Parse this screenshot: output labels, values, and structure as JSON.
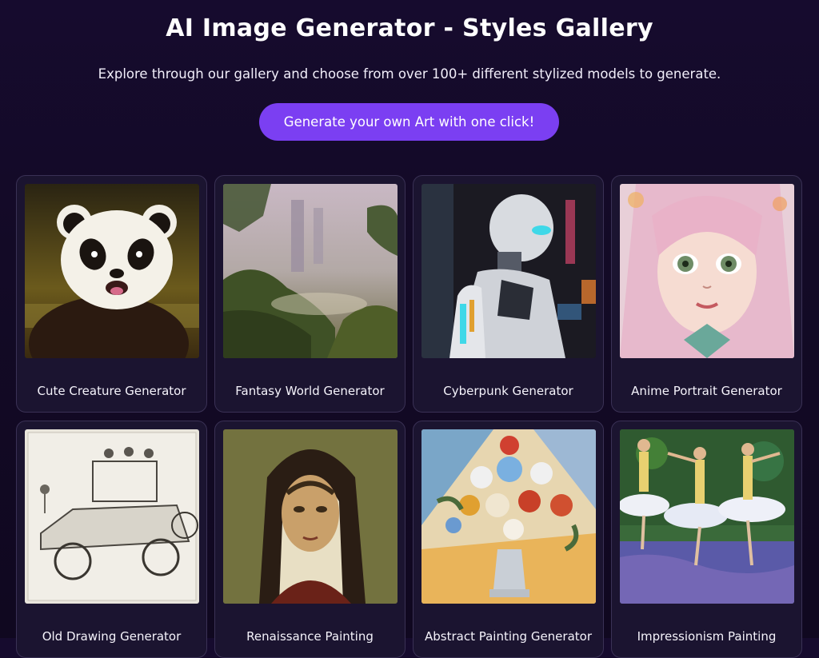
{
  "header": {
    "title": "AI Image Generator - Styles Gallery",
    "subtitle": "Explore through our gallery and choose from over 100+ different stylized models to generate.",
    "cta_label": "Generate your own Art with one click!"
  },
  "colors": {
    "background": "#140a28",
    "accent": "#7b3ff2",
    "card_bg": "#1b1430",
    "card_border": "#3a3155"
  },
  "gallery": {
    "cards": [
      {
        "label": "Cute Creature Generator",
        "image": "panda-image"
      },
      {
        "label": "Fantasy World Generator",
        "image": "fantasy-forest-image"
      },
      {
        "label": "Cyberpunk Generator",
        "image": "cyberpunk-robot-image"
      },
      {
        "label": "Anime Portrait Generator",
        "image": "anime-girl-image"
      },
      {
        "label": "Old Drawing Generator",
        "image": "vintage-car-sketch-image"
      },
      {
        "label": "Renaissance Painting",
        "image": "renaissance-portrait-image"
      },
      {
        "label": "Abstract Painting Generator",
        "image": "flower-vase-painting-image"
      },
      {
        "label": "Impressionism Painting",
        "image": "ballet-dancers-image"
      }
    ]
  }
}
